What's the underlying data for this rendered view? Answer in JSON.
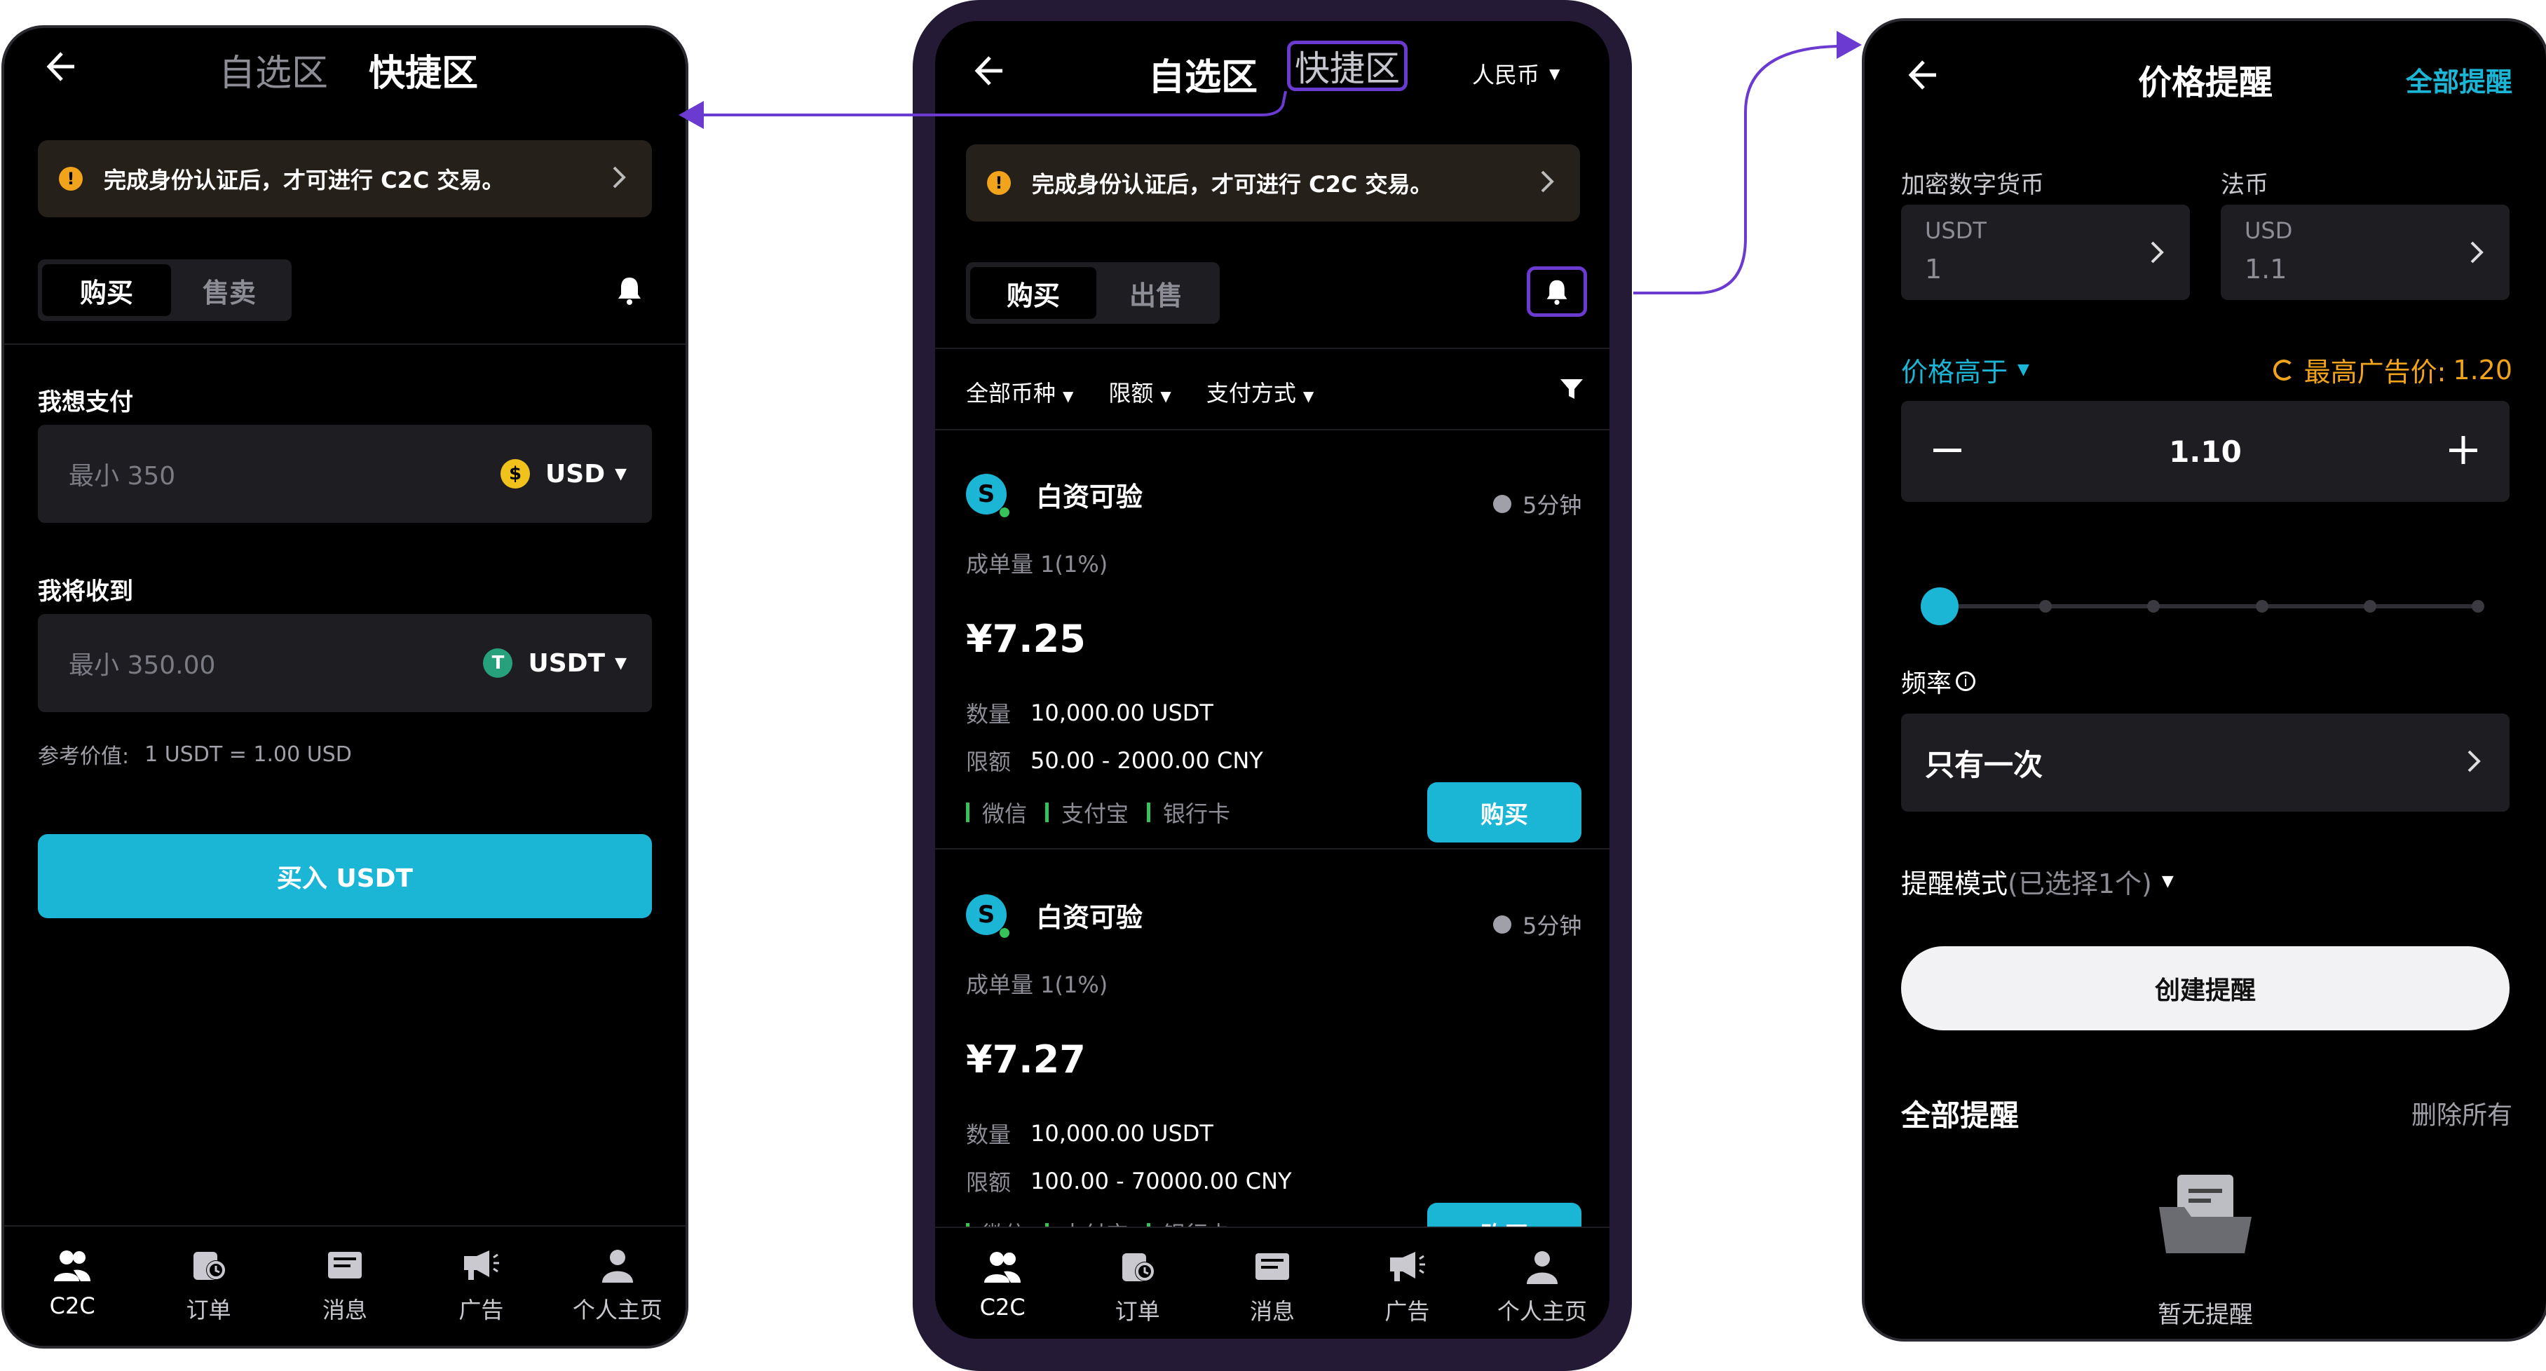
{
  "colors": {
    "accent": "#1bb5d6",
    "highlight": "#6a3ad1",
    "notice": "#f2a31c",
    "success": "#37c15a"
  },
  "left": {
    "tabs": {
      "watchlist": "自选区",
      "quick": "快捷区"
    },
    "notice": "完成身份认证后，才可进行 C2C 交易。",
    "toggle": {
      "buy": "购买",
      "sell": "售卖"
    },
    "pay_label": "我想支付",
    "pay_placeholder": "最小 350",
    "pay_currency": "USD",
    "receive_label": "我将收到",
    "receive_placeholder": "最小 350.00",
    "receive_currency": "USDT",
    "ref_label": "参考价值:",
    "ref_value": "1 USDT = 1.00 USD",
    "buy_button": "买入 USDT"
  },
  "middle": {
    "tabs": {
      "watchlist": "自选区",
      "quick": "快捷区"
    },
    "fiat": "人民币",
    "notice": "完成身份认证后，才可进行 C2C 交易。",
    "toggle": {
      "buy": "购买",
      "sell": "出售"
    },
    "filters": {
      "coin": "全部币种",
      "limit": "限额",
      "payment": "支付方式"
    },
    "listings": [
      {
        "merchant": "白资可验",
        "time": "5分钟",
        "volume": "成单量 1(1%)",
        "price": "¥7.25",
        "qty_label": "数量",
        "qty": "10,000.00 USDT",
        "limit_label": "限额",
        "limit": "50.00 - 2000.00 CNY",
        "methods": [
          "微信",
          "支付宝",
          "银行卡"
        ],
        "buy": "购买"
      },
      {
        "merchant": "白资可验",
        "time": "5分钟",
        "volume": "成单量 1(1%)",
        "price": "¥7.27",
        "qty_label": "数量",
        "qty": "10,000.00 USDT",
        "limit_label": "限额",
        "limit": "100.00 - 70000.00 CNY",
        "methods": [
          "微信",
          "支付宝",
          "银行卡"
        ],
        "buy": "购买"
      }
    ]
  },
  "nav": [
    {
      "label": "C2C",
      "icon": "users-icon"
    },
    {
      "label": "订单",
      "icon": "orders-icon"
    },
    {
      "label": "消息",
      "icon": "message-icon"
    },
    {
      "label": "广告",
      "icon": "megaphone-icon"
    },
    {
      "label": "个人主页",
      "icon": "profile-icon"
    }
  ],
  "right": {
    "title": "价格提醒",
    "all_alerts_link": "全部提醒",
    "crypto_label": "加密数字货币",
    "fiat_label": "法币",
    "crypto_code": "USDT",
    "crypto_value": "1",
    "fiat_code": "USD",
    "fiat_value": "1.1",
    "condition": "价格高于",
    "max_price_label": "最高广告价:",
    "max_price_value": "1.20",
    "stepper_value": "1.10",
    "slider_level": 0,
    "frequency_label": "频率",
    "frequency_value": "只有一次",
    "mode_label": "提醒模式",
    "mode_selected": "(已选择1个)",
    "create_button": "创建提醒",
    "list_title": "全部提醒",
    "delete_all": "删除所有",
    "empty": "暂无提醒"
  }
}
